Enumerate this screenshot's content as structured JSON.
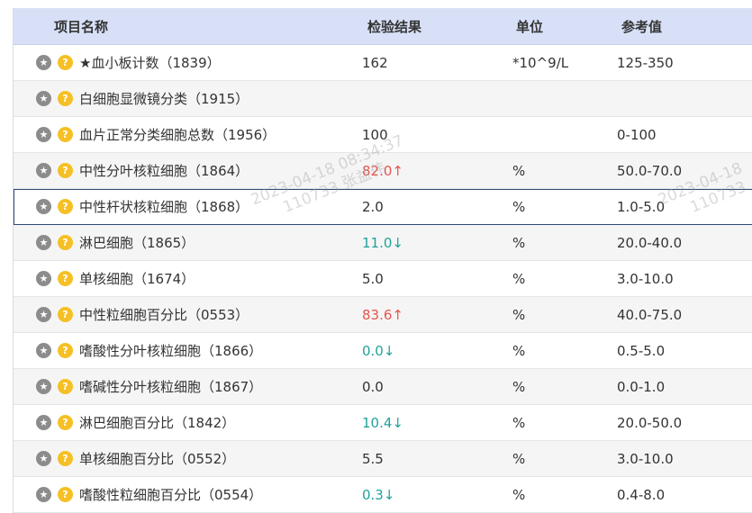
{
  "columns": {
    "name": "项目名称",
    "result": "检验结果",
    "unit": "单位",
    "ref": "参考值"
  },
  "rows": [
    {
      "name": "★血小板计数（1839）",
      "result": "162",
      "flag": "",
      "unit": "*10^9/L",
      "ref": "125-350"
    },
    {
      "name": "白细胞显微镜分类（1915）",
      "result": "",
      "flag": "",
      "unit": "",
      "ref": ""
    },
    {
      "name": "血片正常分类细胞总数（1956）",
      "result": "100",
      "flag": "",
      "unit": "",
      "ref": "0-100"
    },
    {
      "name": "中性分叶核粒细胞（1864）",
      "result": "82.0",
      "flag": "↑",
      "unit": "%",
      "ref": "50.0-70.0"
    },
    {
      "name": "中性杆状核粒细胞（1868）",
      "result": "2.0",
      "flag": "",
      "unit": "%",
      "ref": "1.0-5.0"
    },
    {
      "name": "淋巴细胞（1865）",
      "result": "11.0",
      "flag": "↓",
      "unit": "%",
      "ref": "20.0-40.0"
    },
    {
      "name": "单核细胞（1674）",
      "result": "5.0",
      "flag": "",
      "unit": "%",
      "ref": "3.0-10.0"
    },
    {
      "name": "中性粒细胞百分比（0553）",
      "result": "83.6",
      "flag": "↑",
      "unit": "%",
      "ref": "40.0-75.0"
    },
    {
      "name": "嗜酸性分叶核粒细胞（1866）",
      "result": "0.0",
      "flag": "↓",
      "unit": "%",
      "ref": "0.5-5.0"
    },
    {
      "name": "嗜碱性分叶核粒细胞（1867）",
      "result": "0.0",
      "flag": "",
      "unit": "%",
      "ref": "0.0-1.0"
    },
    {
      "name": "淋巴细胞百分比（1842）",
      "result": "10.4",
      "flag": "↓",
      "unit": "%",
      "ref": "20.0-50.0"
    },
    {
      "name": "单核细胞百分比（0552）",
      "result": "5.5",
      "flag": "",
      "unit": "%",
      "ref": "3.0-10.0"
    },
    {
      "name": "嗜酸性粒细胞百分比（0554）",
      "result": "0.3",
      "flag": "↓",
      "unit": "%",
      "ref": "0.4-8.0"
    }
  ],
  "watermark": {
    "datetime": "2023-04-18 08:34:37",
    "user": "110733 张益伟",
    "datetime_partial": "2023-04-18",
    "user_partial": "110733"
  },
  "icons": {
    "row_icon_1": "star-icon",
    "row_icon_2": "help-icon"
  },
  "colors": {
    "up": "#e8554e",
    "down": "#21a29a",
    "header_bg": "#d7e0f7"
  }
}
